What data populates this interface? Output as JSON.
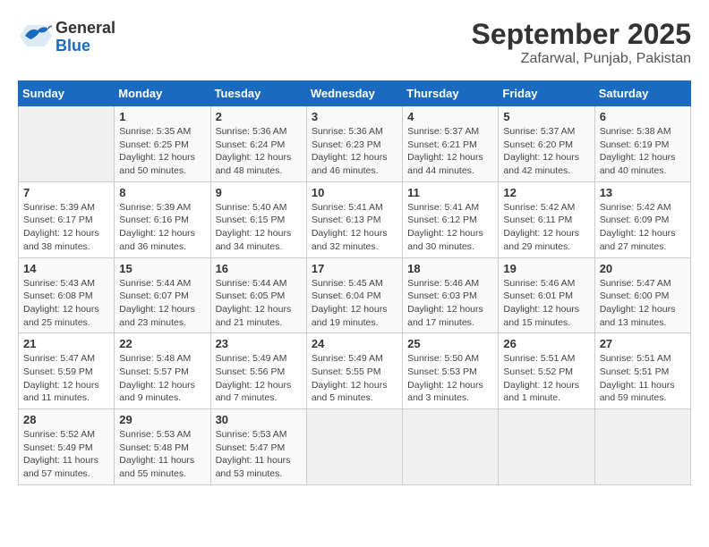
{
  "header": {
    "logo_general": "General",
    "logo_blue": "Blue",
    "title": "September 2025",
    "subtitle": "Zafarwal, Punjab, Pakistan"
  },
  "calendar": {
    "days_of_week": [
      "Sunday",
      "Monday",
      "Tuesday",
      "Wednesday",
      "Thursday",
      "Friday",
      "Saturday"
    ],
    "weeks": [
      [
        {
          "day": "",
          "info": ""
        },
        {
          "day": "1",
          "info": "Sunrise: 5:35 AM\nSunset: 6:25 PM\nDaylight: 12 hours\nand 50 minutes."
        },
        {
          "day": "2",
          "info": "Sunrise: 5:36 AM\nSunset: 6:24 PM\nDaylight: 12 hours\nand 48 minutes."
        },
        {
          "day": "3",
          "info": "Sunrise: 5:36 AM\nSunset: 6:23 PM\nDaylight: 12 hours\nand 46 minutes."
        },
        {
          "day": "4",
          "info": "Sunrise: 5:37 AM\nSunset: 6:21 PM\nDaylight: 12 hours\nand 44 minutes."
        },
        {
          "day": "5",
          "info": "Sunrise: 5:37 AM\nSunset: 6:20 PM\nDaylight: 12 hours\nand 42 minutes."
        },
        {
          "day": "6",
          "info": "Sunrise: 5:38 AM\nSunset: 6:19 PM\nDaylight: 12 hours\nand 40 minutes."
        }
      ],
      [
        {
          "day": "7",
          "info": "Sunrise: 5:39 AM\nSunset: 6:17 PM\nDaylight: 12 hours\nand 38 minutes."
        },
        {
          "day": "8",
          "info": "Sunrise: 5:39 AM\nSunset: 6:16 PM\nDaylight: 12 hours\nand 36 minutes."
        },
        {
          "day": "9",
          "info": "Sunrise: 5:40 AM\nSunset: 6:15 PM\nDaylight: 12 hours\nand 34 minutes."
        },
        {
          "day": "10",
          "info": "Sunrise: 5:41 AM\nSunset: 6:13 PM\nDaylight: 12 hours\nand 32 minutes."
        },
        {
          "day": "11",
          "info": "Sunrise: 5:41 AM\nSunset: 6:12 PM\nDaylight: 12 hours\nand 30 minutes."
        },
        {
          "day": "12",
          "info": "Sunrise: 5:42 AM\nSunset: 6:11 PM\nDaylight: 12 hours\nand 29 minutes."
        },
        {
          "day": "13",
          "info": "Sunrise: 5:42 AM\nSunset: 6:09 PM\nDaylight: 12 hours\nand 27 minutes."
        }
      ],
      [
        {
          "day": "14",
          "info": "Sunrise: 5:43 AM\nSunset: 6:08 PM\nDaylight: 12 hours\nand 25 minutes."
        },
        {
          "day": "15",
          "info": "Sunrise: 5:44 AM\nSunset: 6:07 PM\nDaylight: 12 hours\nand 23 minutes."
        },
        {
          "day": "16",
          "info": "Sunrise: 5:44 AM\nSunset: 6:05 PM\nDaylight: 12 hours\nand 21 minutes."
        },
        {
          "day": "17",
          "info": "Sunrise: 5:45 AM\nSunset: 6:04 PM\nDaylight: 12 hours\nand 19 minutes."
        },
        {
          "day": "18",
          "info": "Sunrise: 5:46 AM\nSunset: 6:03 PM\nDaylight: 12 hours\nand 17 minutes."
        },
        {
          "day": "19",
          "info": "Sunrise: 5:46 AM\nSunset: 6:01 PM\nDaylight: 12 hours\nand 15 minutes."
        },
        {
          "day": "20",
          "info": "Sunrise: 5:47 AM\nSunset: 6:00 PM\nDaylight: 12 hours\nand 13 minutes."
        }
      ],
      [
        {
          "day": "21",
          "info": "Sunrise: 5:47 AM\nSunset: 5:59 PM\nDaylight: 12 hours\nand 11 minutes."
        },
        {
          "day": "22",
          "info": "Sunrise: 5:48 AM\nSunset: 5:57 PM\nDaylight: 12 hours\nand 9 minutes."
        },
        {
          "day": "23",
          "info": "Sunrise: 5:49 AM\nSunset: 5:56 PM\nDaylight: 12 hours\nand 7 minutes."
        },
        {
          "day": "24",
          "info": "Sunrise: 5:49 AM\nSunset: 5:55 PM\nDaylight: 12 hours\nand 5 minutes."
        },
        {
          "day": "25",
          "info": "Sunrise: 5:50 AM\nSunset: 5:53 PM\nDaylight: 12 hours\nand 3 minutes."
        },
        {
          "day": "26",
          "info": "Sunrise: 5:51 AM\nSunset: 5:52 PM\nDaylight: 12 hours\nand 1 minute."
        },
        {
          "day": "27",
          "info": "Sunrise: 5:51 AM\nSunset: 5:51 PM\nDaylight: 11 hours\nand 59 minutes."
        }
      ],
      [
        {
          "day": "28",
          "info": "Sunrise: 5:52 AM\nSunset: 5:49 PM\nDaylight: 11 hours\nand 57 minutes."
        },
        {
          "day": "29",
          "info": "Sunrise: 5:53 AM\nSunset: 5:48 PM\nDaylight: 11 hours\nand 55 minutes."
        },
        {
          "day": "30",
          "info": "Sunrise: 5:53 AM\nSunset: 5:47 PM\nDaylight: 11 hours\nand 53 minutes."
        },
        {
          "day": "",
          "info": ""
        },
        {
          "day": "",
          "info": ""
        },
        {
          "day": "",
          "info": ""
        },
        {
          "day": "",
          "info": ""
        }
      ]
    ]
  }
}
